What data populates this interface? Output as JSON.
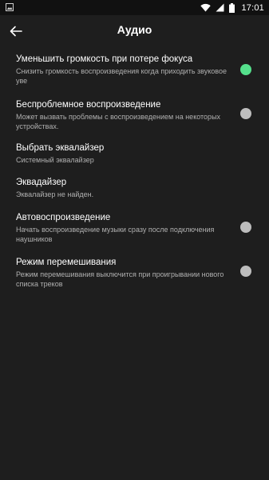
{
  "status_bar": {
    "time": "17:01",
    "icons": [
      "image-icon",
      "wifi-icon",
      "signal-icon",
      "battery-icon"
    ]
  },
  "app_bar": {
    "title": "Аудио",
    "back_icon": "arrow-left-icon"
  },
  "settings": [
    {
      "title": "Уменьшить громкость при потере фокуса",
      "summary": "Снизить громкость воспроизведения когда приходить звуковое уве",
      "has_toggle": true,
      "toggle_on": true
    },
    {
      "title": "Беспроблемное воспроизведение",
      "summary": "Может вызвать проблемы с воспроизведением на некоторых устройствах.",
      "has_toggle": true,
      "toggle_on": false
    },
    {
      "title": "Выбрать эквалайзер",
      "summary": "Системный эквалайзер",
      "has_toggle": false
    },
    {
      "title": "Эквадайзер",
      "summary": "Эквалайзер не найден.",
      "has_toggle": false
    },
    {
      "title": "Автовоспроизведение",
      "summary": "Начать воспроизведение музыки сразу после подключения наушников",
      "has_toggle": true,
      "toggle_on": false
    },
    {
      "title": "Режим перемешивания",
      "summary": "Режим перемешивания выключится при проигрывании нового списка треков",
      "has_toggle": true,
      "toggle_on": false
    }
  ],
  "colors": {
    "background": "#1e1e1e",
    "status_bar": "#111111",
    "toggle_on": "#55e08c",
    "toggle_off": "#bdbdbd",
    "summary_text": "#b0b0b0"
  }
}
